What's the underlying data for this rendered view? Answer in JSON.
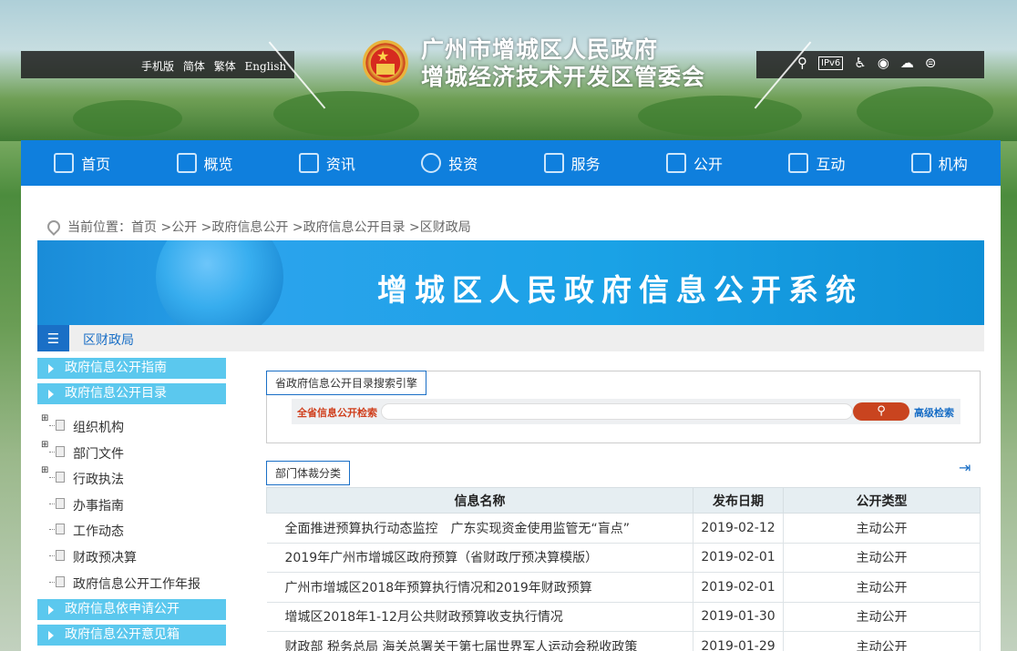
{
  "header": {
    "lang_links": [
      "手机版",
      "简体",
      "繁体",
      "English"
    ],
    "title_line1": "广州市增城区人民政府",
    "title_line2": "增城经济技术开发区管委会",
    "top_icons": [
      "search-icon",
      "ipv6-badge",
      "accessibility-icon",
      "weibo-icon",
      "wechat-icon",
      "rss-icon"
    ],
    "ipv6_label": "IPv6"
  },
  "nav": {
    "items": [
      {
        "label": "首页",
        "icon": "home-icon"
      },
      {
        "label": "概览",
        "icon": "overview-icon"
      },
      {
        "label": "资讯",
        "icon": "news-icon"
      },
      {
        "label": "投资",
        "icon": "globe-icon"
      },
      {
        "label": "服务",
        "icon": "briefcase-icon"
      },
      {
        "label": "公开",
        "icon": "monitor-icon"
      },
      {
        "label": "互动",
        "icon": "chat-icon"
      },
      {
        "label": "机构",
        "icon": "org-chart-icon"
      }
    ]
  },
  "breadcrumb": {
    "prefix": "当前位置：",
    "items": [
      "首页",
      "公开",
      "政府信息公开",
      "政府信息公开目录",
      "区财政局"
    ]
  },
  "banner": {
    "title": "增城区人民政府信息公开系统"
  },
  "subbar": {
    "label": "区财政局"
  },
  "sidebar": {
    "top_buttons": [
      "政府信息公开指南",
      "政府信息公开目录"
    ],
    "tree": [
      {
        "label": "组织机构",
        "expandable": true
      },
      {
        "label": "部门文件",
        "expandable": true
      },
      {
        "label": "行政执法",
        "expandable": true
      },
      {
        "label": "办事指南",
        "expandable": false
      },
      {
        "label": "工作动态",
        "expandable": false
      },
      {
        "label": "财政预决算",
        "expandable": false
      },
      {
        "label": "政府信息公开工作年报",
        "expandable": false
      }
    ],
    "bottom_buttons": [
      "政府信息依申请公开",
      "政府信息公开意见箱"
    ]
  },
  "search": {
    "box_title": "省政府信息公开目录搜索引擎",
    "label": "全省信息公开检索",
    "placeholder": "",
    "advanced": "高级检索"
  },
  "listing": {
    "section_title": "部门体裁分类",
    "columns": [
      "信息名称",
      "发布日期",
      "公开类型"
    ],
    "rows": [
      {
        "name": "全面推进预算执行动态监控　广东实现资金使用监管无“盲点”",
        "date": "2019-02-12",
        "type": "主动公开"
      },
      {
        "name": "2019年广州市增城区政府预算（省财政厅预决算模版）",
        "date": "2019-02-01",
        "type": "主动公开"
      },
      {
        "name": "广州市增城区2018年预算执行情况和2019年财政预算",
        "date": "2019-02-01",
        "type": "主动公开"
      },
      {
        "name": "增城区2018年1-12月公共财政预算收支执行情况",
        "date": "2019-01-30",
        "type": "主动公开"
      },
      {
        "name": "财政部 税务总局 海关总署关于第七届世界军人运动会税收政策",
        "date": "2019-01-29",
        "type": "主动公开"
      }
    ]
  }
}
